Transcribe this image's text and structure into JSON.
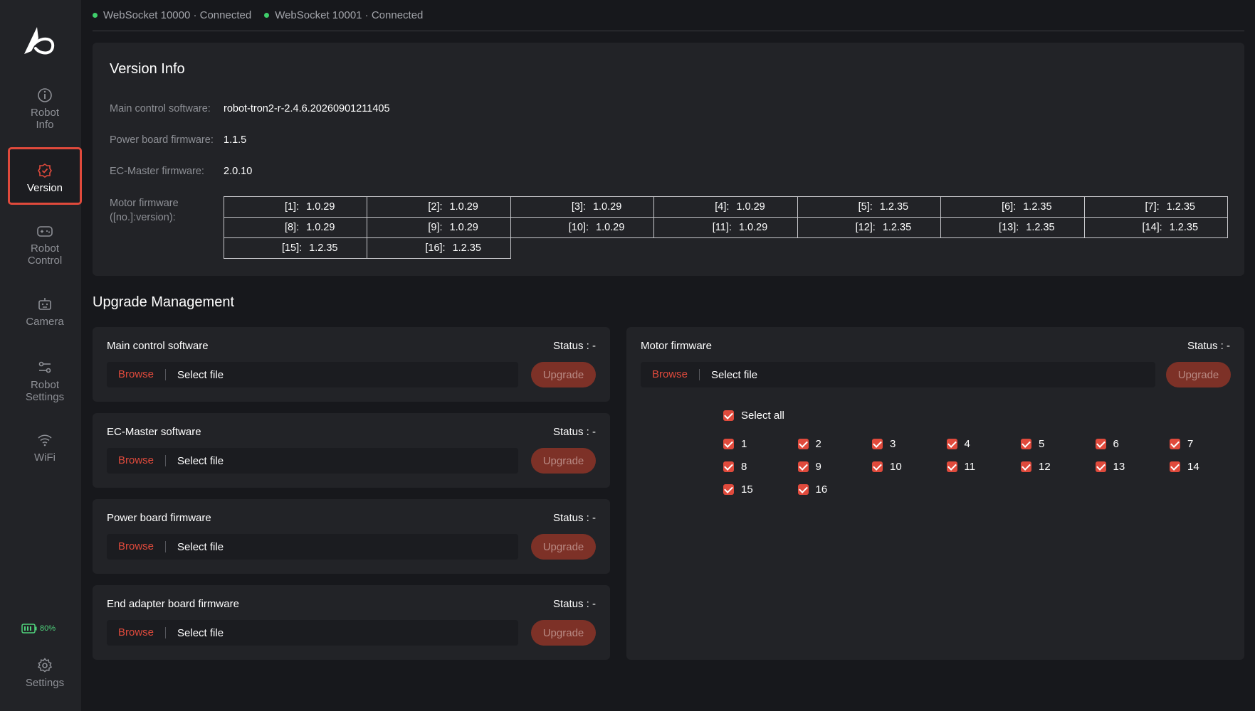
{
  "sidebar": {
    "items": [
      {
        "label": "Robot\nInfo",
        "icon": "info-icon"
      },
      {
        "label": "Version",
        "icon": "version-badge-icon"
      },
      {
        "label": "Robot\nControl",
        "icon": "gamepad-icon"
      },
      {
        "label": "Camera",
        "icon": "camera-icon"
      },
      {
        "label": "Robot\nSettings",
        "icon": "sliders-icon"
      },
      {
        "label": "WiFi",
        "icon": "wifi-icon"
      }
    ],
    "battery": "80%",
    "settings_label": "Settings"
  },
  "topbar": {
    "conn1": "WebSocket 10000 · Connected",
    "conn2": "WebSocket 10001 · Connected"
  },
  "version_info": {
    "title": "Version Info",
    "main_label": "Main control software:",
    "main_value": "robot-tron2-r-2.4.6.20260901211405",
    "power_label": "Power board firmware:",
    "power_value": "1.1.5",
    "ec_label": "EC-Master firmware:",
    "ec_value": "2.0.10",
    "motor_label": "Motor firmware",
    "motor_label2": "([no.]:version):",
    "motors": [
      {
        "k": "[1]:",
        "v": "1.0.29"
      },
      {
        "k": "[2]:",
        "v": "1.0.29"
      },
      {
        "k": "[3]:",
        "v": "1.0.29"
      },
      {
        "k": "[4]:",
        "v": "1.0.29"
      },
      {
        "k": "[5]:",
        "v": "1.2.35"
      },
      {
        "k": "[6]:",
        "v": "1.2.35"
      },
      {
        "k": "[7]:",
        "v": "1.2.35"
      },
      {
        "k": "[8]:",
        "v": "1.0.29"
      },
      {
        "k": "[9]:",
        "v": "1.0.29"
      },
      {
        "k": "[10]:",
        "v": "1.0.29"
      },
      {
        "k": "[11]:",
        "v": "1.0.29"
      },
      {
        "k": "[12]:",
        "v": "1.2.35"
      },
      {
        "k": "[13]:",
        "v": "1.2.35"
      },
      {
        "k": "[14]:",
        "v": "1.2.35"
      },
      {
        "k": "[15]:",
        "v": "1.2.35"
      },
      {
        "k": "[16]:",
        "v": "1.2.35"
      }
    ]
  },
  "upgrade": {
    "title": "Upgrade Management",
    "cards": [
      {
        "title": "Main control software",
        "status": "Status : -",
        "browse": "Browse",
        "file": "Select file",
        "button": "Upgrade"
      },
      {
        "title": "EC-Master software",
        "status": "Status : -",
        "browse": "Browse",
        "file": "Select file",
        "button": "Upgrade"
      },
      {
        "title": "Power board firmware",
        "status": "Status : -",
        "browse": "Browse",
        "file": "Select file",
        "button": "Upgrade"
      },
      {
        "title": "End adapter board firmware",
        "status": "Status : -",
        "browse": "Browse",
        "file": "Select file",
        "button": "Upgrade"
      }
    ],
    "motor": {
      "title": "Motor firmware",
      "status": "Status : -",
      "browse": "Browse",
      "file": "Select file",
      "button": "Upgrade",
      "select_all": "Select all",
      "motors": [
        "1",
        "2",
        "3",
        "4",
        "5",
        "6",
        "7",
        "8",
        "9",
        "10",
        "11",
        "12",
        "13",
        "14",
        "15",
        "16"
      ]
    }
  },
  "colors": {
    "accent": "#e04a3c",
    "connected": "#3fcf6b",
    "battery": "#4fd37c"
  }
}
